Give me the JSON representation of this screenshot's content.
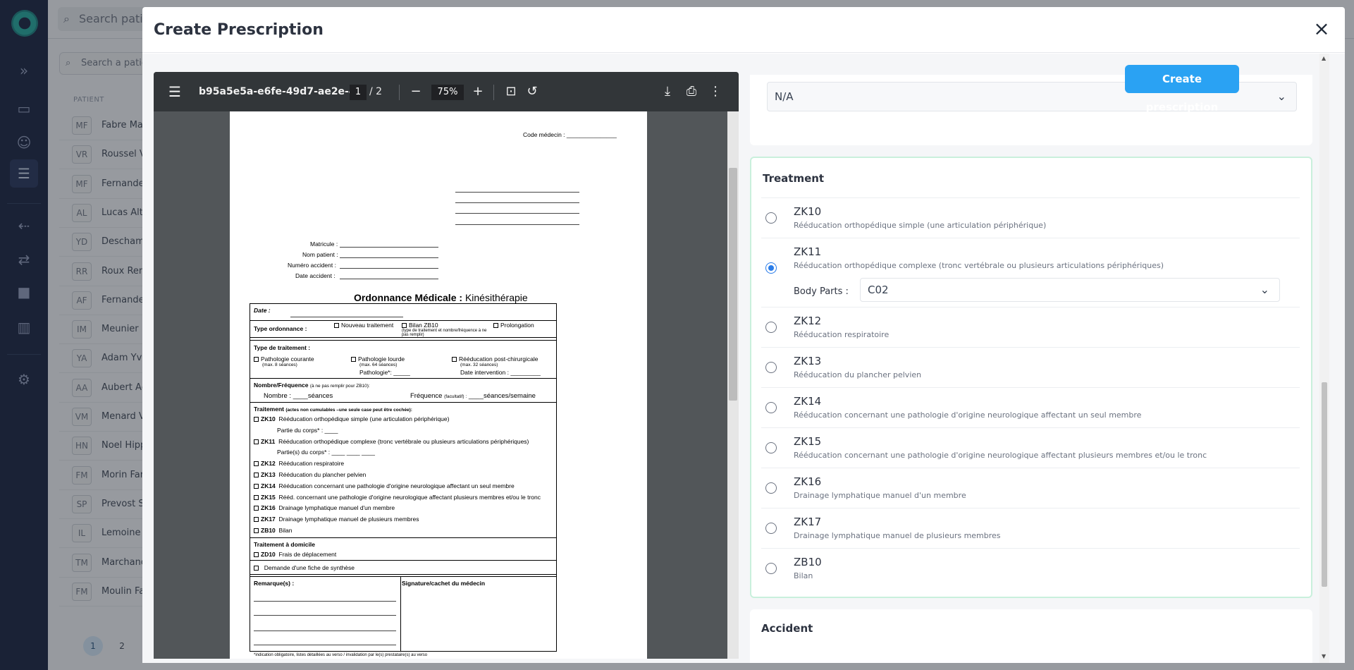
{
  "background": {
    "search_placeholder": "Search patie",
    "search2_placeholder": "Search a patie",
    "column_header": "PATIENT",
    "patients": [
      {
        "initials": "MF",
        "name": "Fabre Mag"
      },
      {
        "initials": "VR",
        "name": "Roussel Vi"
      },
      {
        "initials": "MF",
        "name": "Fernande"
      },
      {
        "initials": "AL",
        "name": "Lucas Alth"
      },
      {
        "initials": "YD",
        "name": "Deschamp"
      },
      {
        "initials": "RR",
        "name": "Roux Rena"
      },
      {
        "initials": "AF",
        "name": "Fernandez"
      },
      {
        "initials": "IM",
        "name": "Meunier Is"
      },
      {
        "initials": "YA",
        "name": "Adam Yvet"
      },
      {
        "initials": "AA",
        "name": "Aubert Ag"
      },
      {
        "initials": "VM",
        "name": "Menard Vi"
      },
      {
        "initials": "HN",
        "name": "Noel Hipp"
      },
      {
        "initials": "FM",
        "name": "Morin Far"
      },
      {
        "initials": "SP",
        "name": "Prevost Sé"
      },
      {
        "initials": "IL",
        "name": "Lemoine In"
      },
      {
        "initials": "TM",
        "name": "Marchand"
      },
      {
        "initials": "FM",
        "name": "Moulin Fa"
      }
    ],
    "pages": [
      "1",
      "2"
    ]
  },
  "modal": {
    "title": "Create Prescription",
    "close_icon": "×"
  },
  "pdf": {
    "filename": "b95a5e5a-e6fe-49d7-ae2e-4...",
    "page_current": "1",
    "page_total": "2",
    "zoom": "75%",
    "doc": {
      "code_medecin": "Code médecin : _______________",
      "matricule": "Matricule :",
      "nom_patient": "Nom patient :",
      "numero_accident": "Numéro accident :",
      "date_accident": "Date accident :",
      "title_bold": "Ordonnance Médicale :",
      "title_rest": "Kinésithérapie",
      "date_label": "Date :",
      "type_ordonnance": "Type ordonnance :",
      "nouveau": "Nouveau traitement",
      "bilan": "Bilan ZB10",
      "bilan_note": "(type de traitement et nombre/fréquence à ne pas remplir)",
      "prolongation": "Prolongation",
      "type_traitement": "Type de traitement :",
      "path_courante": "Pathologie courante",
      "path_courante_max": "(max. 8 séances)",
      "path_lourde": "Pathologie lourde",
      "path_lourde_max": "(max. 64 séances)",
      "path_lourde_field": "Pathologie*: _____",
      "post_chir": "Rééducation post-chirurgicale",
      "post_chir_max": "(max. 32 séances)",
      "date_intervention": "Date intervention : _________",
      "nombre_freq": "Nombre/Fréquence",
      "nombre_freq_note": "(à ne pas remplir pour ZB10):",
      "nombre": "Nombre :    ____séances",
      "frequence": "Fréquence",
      "frequence_note": "(facultatif) :",
      "frequence_val": "____séances/semaine",
      "traitement_head": "Traitement",
      "traitement_note": "(actes non cumulables –une seule case peut être cochée):",
      "lines": [
        {
          "code": "ZK10",
          "text": "Rééducation orthopédique simple (une articulation périphérique)"
        },
        {
          "code": "",
          "text": "Partie du corps* :    ____"
        },
        {
          "code": "ZK11",
          "text": "Rééducation orthopédique complexe (tronc vertébrale ou plusieurs articulations périphériques)"
        },
        {
          "code": "",
          "text": "Partie(s) du corps* :    ____    ____    ____"
        },
        {
          "code": "ZK12",
          "text": "Rééducation respiratoire"
        },
        {
          "code": "ZK13",
          "text": "Rééducation du plancher pelvien"
        },
        {
          "code": "ZK14",
          "text": "Rééducation concernant une pathologie d'origine neurologique affectant un seul membre"
        },
        {
          "code": "ZK15",
          "text": "Rééd. concernant une pathologie d'origine neurologique affectant plusieurs membres et/ou le tronc"
        },
        {
          "code": "ZK16",
          "text": "Drainage lymphatique manuel d'un membre"
        },
        {
          "code": "ZK17",
          "text": "Drainage lymphatique manuel de plusieurs membres"
        },
        {
          "code": "ZB10",
          "text": "Bilan"
        }
      ],
      "domicile": "Traitement à domicile",
      "zd10_code": "ZD10",
      "zd10_text": "Frais de déplacement",
      "fiche": "Demande d'une fiche de synthèse",
      "remarques": "Remarque(s) :",
      "signature": "Signature/cachet du médecin",
      "footnote": "*indication obligatoire, listes détaillées au verso / invalidation par le(s) prestataire(s) au verso"
    }
  },
  "form": {
    "create_button": "Create prescription",
    "top_select_value": "N/A",
    "treatment_title": "Treatment",
    "options": [
      {
        "code": "ZK10",
        "desc": "Rééducation orthopédique simple (une articulation périphérique)",
        "selected": false
      },
      {
        "code": "ZK11",
        "desc": "Rééducation orthopédique complexe (tronc vertébrale ou plusieurs articulations périphériques)",
        "selected": true
      },
      {
        "code": "ZK12",
        "desc": "Rééducation respiratoire",
        "selected": false
      },
      {
        "code": "ZK13",
        "desc": "Rééducation du plancher pelvien",
        "selected": false
      },
      {
        "code": "ZK14",
        "desc": "Rééducation concernant une pathologie d'origine neurologique affectant un seul membre",
        "selected": false
      },
      {
        "code": "ZK15",
        "desc": "Rééducation concernant une pathologie d'origine neurologique affectant plusieurs membres et/ou le tronc",
        "selected": false
      },
      {
        "code": "ZK16",
        "desc": "Drainage lymphatique manuel d'un membre",
        "selected": false
      },
      {
        "code": "ZK17",
        "desc": "Drainage lymphatique manuel de plusieurs membres",
        "selected": false
      },
      {
        "code": "ZB10",
        "desc": "Bilan",
        "selected": false
      }
    ],
    "body_parts_label": "Body Parts :",
    "body_parts_value": "C02",
    "accident_title": "Accident"
  },
  "colors": {
    "primary_button": "#2aa2f3",
    "selected_radio": "#2b7de9",
    "treatment_border": "#c9f0dc",
    "sidebar": "#0f1a3a"
  }
}
